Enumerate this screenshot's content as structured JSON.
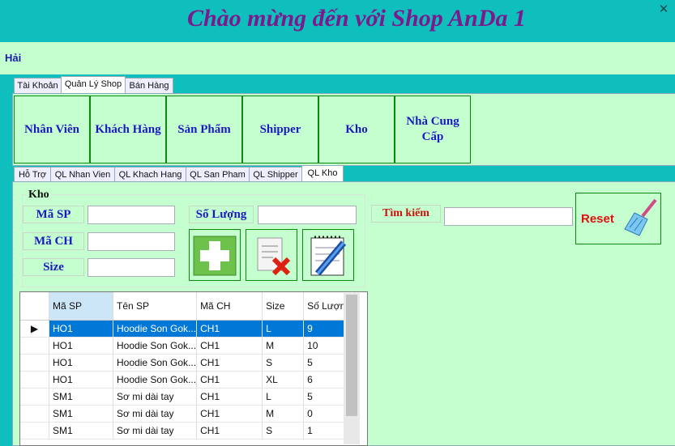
{
  "window": {
    "title": "Chào mừng đến với Shop AnDa 1",
    "close_glyph": "✕"
  },
  "user": {
    "name": "Hải"
  },
  "main_tabs": [
    "Tài Khoản",
    "Quản Lý Shop",
    "Bán Hàng"
  ],
  "manage_buttons": [
    "Nhân Viên",
    "Khách Hàng",
    "Sản Phẩm",
    "Shipper",
    "Kho",
    "Nhà Cung Cấp"
  ],
  "sub_tabs": [
    "Hỗ Trợ",
    "QL Nhan Vien",
    "QL Khach Hang",
    "QL San Pham",
    "QL Shipper",
    "QL Kho"
  ],
  "kho": {
    "group_title": "Kho",
    "labels": {
      "ma_sp": "Mã SP",
      "ma_ch": "Mã CH",
      "size": "Size",
      "so_luong": "Số Lượng",
      "tim_kiem": "Tìm kiếm"
    },
    "values": {
      "ma_sp": "",
      "ma_ch": "",
      "size": "",
      "so_luong": "",
      "tim_kiem": ""
    },
    "reset_label": "Reset"
  },
  "grid": {
    "columns": [
      "Mã SP",
      "Tên SP",
      "Mã CH",
      "Size",
      "Số Lượng"
    ],
    "rows": [
      [
        "HO1",
        "Hoodie Son Gok...",
        "CH1",
        "L",
        "9"
      ],
      [
        "HO1",
        "Hoodie Son Gok...",
        "CH1",
        "M",
        "10"
      ],
      [
        "HO1",
        "Hoodie Son Gok...",
        "CH1",
        "S",
        "5"
      ],
      [
        "HO1",
        "Hoodie Son Gok...",
        "CH1",
        "XL",
        "6"
      ],
      [
        "SM1",
        "Sơ mi dài tay",
        "CH1",
        "L",
        "5"
      ],
      [
        "SM1",
        "Sơ mi dài tay",
        "CH1",
        "M",
        "0"
      ],
      [
        "SM1",
        "Sơ mi dài tay",
        "CH1",
        "S",
        "1"
      ]
    ],
    "selected_row": 0
  },
  "icons": [
    "close-icon",
    "add-icon",
    "delete-icon",
    "edit-icon",
    "broom-icon",
    "row-pointer-icon"
  ],
  "colors": {
    "background": "#0fbfbe",
    "panel": "#c5ffcf",
    "title": "#7a1a8c",
    "label": "#1a1ac0",
    "accent_red": "#d01010",
    "selection": "#0078d7"
  }
}
